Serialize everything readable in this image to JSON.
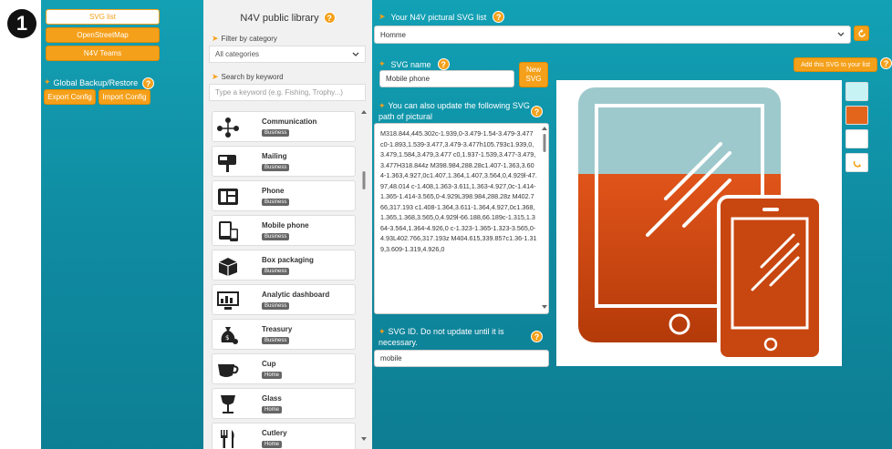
{
  "step": "1",
  "left": {
    "buttons": [
      "SVG list",
      "OpenStreetMap",
      "N4V Teams"
    ],
    "backup_label": "Global Backup/Restore",
    "export_label": "Export Config",
    "import_label": "Import Config"
  },
  "library": {
    "title": "N4V public library",
    "filter_label": "Filter by category",
    "category_value": "All categories",
    "search_label": "Search by keyword",
    "search_placeholder": "Type a keyword (e.g. Fishing, Trophy...)",
    "items": [
      {
        "name": "Communication",
        "category": "Business",
        "icon": "communication-icon"
      },
      {
        "name": "Mailing",
        "category": "Business",
        "icon": "mailbox-icon"
      },
      {
        "name": "Phone",
        "category": "Business",
        "icon": "phone-icon"
      },
      {
        "name": "Mobile phone",
        "category": "Business",
        "icon": "mobile-phone-icon"
      },
      {
        "name": "Box packaging",
        "category": "Business",
        "icon": "box-icon"
      },
      {
        "name": "Analytic dashboard",
        "category": "Business",
        "icon": "dashboard-icon"
      },
      {
        "name": "Treasury",
        "category": "Business",
        "icon": "money-bag-icon"
      },
      {
        "name": "Cup",
        "category": "Home",
        "icon": "cup-icon"
      },
      {
        "name": "Glass",
        "category": "Home",
        "icon": "glass-icon"
      },
      {
        "name": "Cutlery",
        "category": "Home",
        "icon": "cutlery-icon"
      }
    ]
  },
  "main": {
    "list_label": "Your N4V pictural SVG list",
    "list_value": "Homme",
    "svg_name_label": "SVG name",
    "svg_name_value": "Mobile phone",
    "new_svg_label": "New SVG",
    "add_label": "Add this SVG to your list",
    "path_label": "You can also update the following SVG path of pictural",
    "path_text": "M318.844,445.302c-1.939,0-3.479-1.54-3.479-3.477    c0-1.893,1.539-3.477,3.479-3.477h105.793c1.939,0,3.479,1.584,3.479,3.477 c0,1.937-1.539,3.477-3.479,3.477H318.844z M398.984,288.28c1.407-1.363,3.604-1.363,4.927,0c1.407,1.364,1.407,3.564,0,4.929l-47.97,48.014    c-1.408,1.363-3.611,1.363-4.927,0c-1.414-1.365-1.414-3.565,0-4.929L398.984,288.28z M402.766,317.193 c1.408-1.364,3.611-1.364,4.927,0c1.368,1.365,1.368,3.565,0,4.929l-66.188,66.189c-1.315,1.364-3.564,1.364-4.926,0    c-1.323-1.365-1.323-3.565,0-4.93L402.766,317.193z M404.615,339.857c1.36-1.319,3.609-1.319,4.926,0",
    "svg_id_label": "SVG ID. Do not update until it is necessary.",
    "svg_id_value": "mobile",
    "swatches": [
      "#c8f3f4",
      "#e3651c",
      "#ffffff"
    ],
    "gradient_colors": [
      "#9ec9cc",
      "#e0541a",
      "#b43a09"
    ]
  }
}
